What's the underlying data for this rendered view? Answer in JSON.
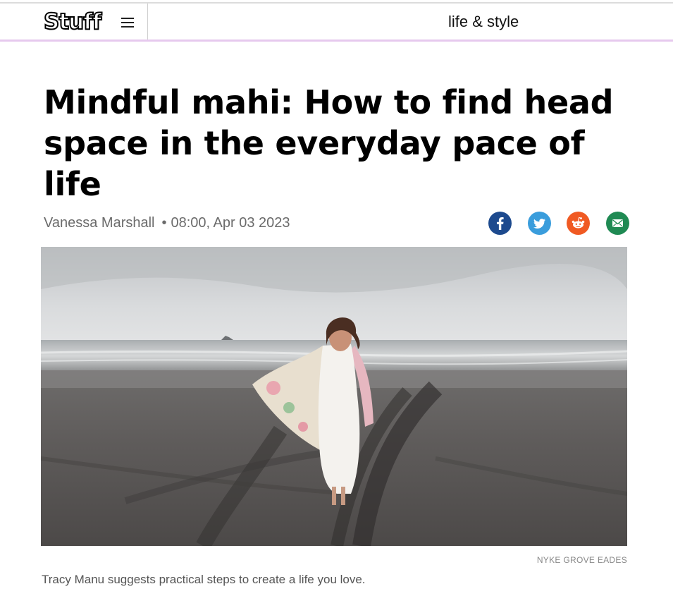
{
  "header": {
    "logo_text": "Stuff",
    "section": "life & style",
    "menu_icon": "hamburger-menu-icon",
    "accent_line_color": "#e6c9ee"
  },
  "article": {
    "headline": "Mindful mahi: How to find head space in the everyday pace of life",
    "author": "Vanessa Marshall",
    "separator": "•",
    "timestamp": "08:00, Apr 03 2023",
    "share": [
      {
        "network": "facebook",
        "icon": "facebook-icon",
        "color": "#1d4a8e"
      },
      {
        "network": "twitter",
        "icon": "twitter-icon",
        "color": "#3a9ddc"
      },
      {
        "network": "reddit",
        "icon": "reddit-icon",
        "color": "#f05a23"
      },
      {
        "network": "email",
        "icon": "email-icon",
        "color": "#1f8a53"
      }
    ],
    "image_credit": "NYKE GROVE EADES",
    "caption": "Tracy Manu suggests practical steps to create a life you love."
  }
}
